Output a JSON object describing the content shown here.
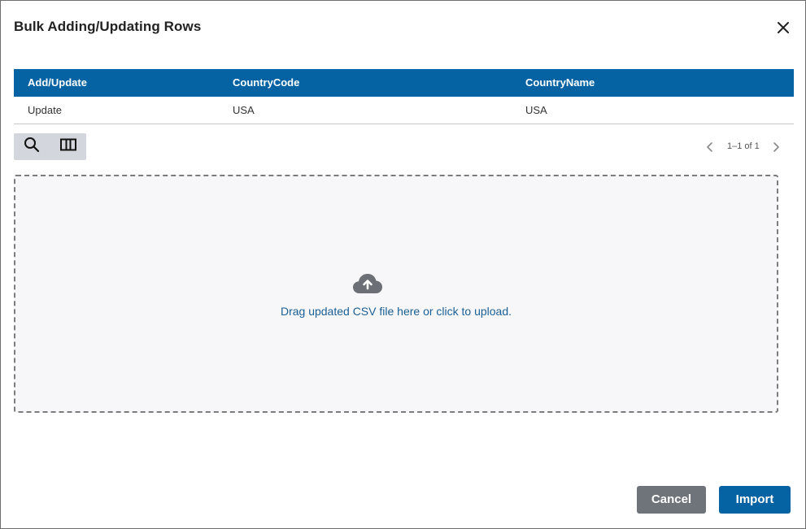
{
  "dialog": {
    "title": "Bulk Adding/Updating Rows"
  },
  "grid": {
    "columns": [
      "Add/Update",
      "CountryCode",
      "CountryName"
    ],
    "rows": [
      [
        "Update",
        "USA",
        "USA"
      ]
    ]
  },
  "toolbar": {
    "search_icon": "search-icon",
    "columns_icon": "columns-icon"
  },
  "pager": {
    "text": "1–1 of 1"
  },
  "dropzone": {
    "icon": "cloud-upload-icon",
    "text": "Drag updated CSV file here or click to upload."
  },
  "actions": {
    "cancel_label": "Cancel",
    "import_label": "Import"
  },
  "colors": {
    "header_bg": "#0562a3",
    "import_bg": "#0562a3",
    "cancel_bg": "#6f737a",
    "link_text": "#1a5f95"
  }
}
